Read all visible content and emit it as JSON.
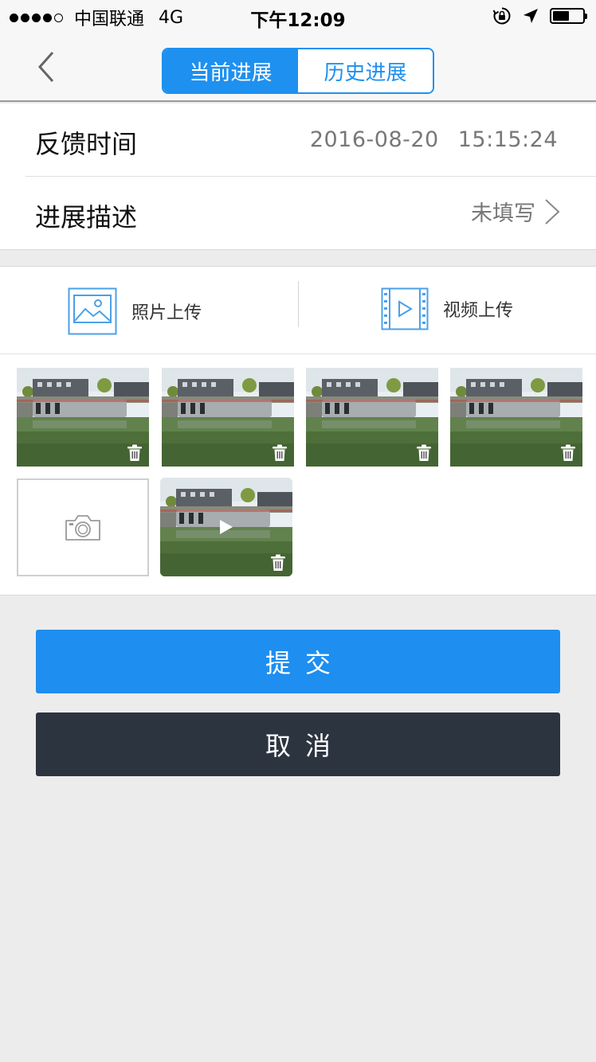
{
  "status_bar": {
    "carrier": "中国联通",
    "network": "4G",
    "time": "下午12:09",
    "battery_level": 0.55
  },
  "nav": {
    "back_icon": "chevron-left-icon",
    "tabs": [
      {
        "label": "当前进展",
        "active": true
      },
      {
        "label": "历史进展",
        "active": false
      }
    ]
  },
  "info": {
    "feedback_time_label": "反馈时间",
    "feedback_date": "2016-08-20",
    "feedback_clock": "15:15:24",
    "progress_label": "进展描述",
    "progress_value": "未填写"
  },
  "upload": {
    "photo_label": "照片上传",
    "video_label": "视频上传"
  },
  "actions": {
    "submit": "提交",
    "cancel": "取消"
  },
  "colors": {
    "accent": "#1e90f0",
    "cancel_bg": "#2c3440",
    "page_bg": "#ececec"
  }
}
